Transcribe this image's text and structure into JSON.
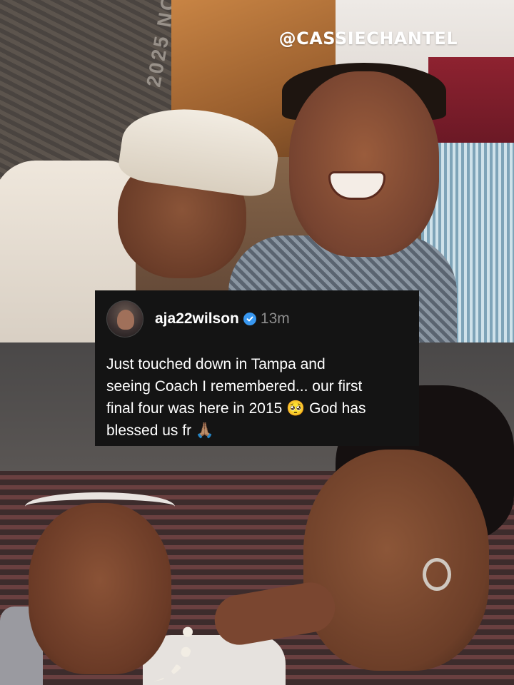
{
  "watermark": {
    "handle": "@CASSIECHANTEL"
  },
  "post": {
    "username": "aja22wilson",
    "verified": true,
    "timestamp": "13m",
    "caption": "Just touched down in Tampa and\nseeing Coach I remembered... our first\nfinal four was here in 2015 🥺 God has\nblessed us fr 🙏🏽"
  },
  "background_photo_top": {
    "banner_text": "2025 NO"
  },
  "colors": {
    "card_bg": "#141414",
    "verified_blue": "#3897f0",
    "timestamp_gray": "#8e8e8e"
  }
}
